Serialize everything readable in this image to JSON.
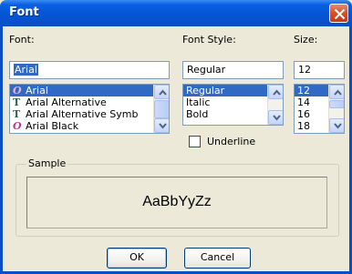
{
  "window": {
    "title": "Font"
  },
  "font": {
    "label": "Font:",
    "value": "Arial",
    "items": [
      {
        "name": "Arial",
        "icon": "opentype-icon"
      },
      {
        "name": "Arial Alternative",
        "icon": "truetype-icon"
      },
      {
        "name": "Arial Alternative Symb",
        "icon": "truetype-icon"
      },
      {
        "name": "Arial Black",
        "icon": "opentype-icon"
      }
    ]
  },
  "style": {
    "label": "Font Style:",
    "value": "Regular",
    "items": [
      "Regular",
      "Italic",
      "Bold"
    ]
  },
  "size": {
    "label": "Size:",
    "value": "12",
    "items": [
      "12",
      "14",
      "16",
      "18"
    ]
  },
  "underline": {
    "label": "Underline",
    "checked": false
  },
  "sample": {
    "legend": "Sample",
    "text": "AaBbYyZz"
  },
  "buttons": {
    "ok": "OK",
    "cancel": "Cancel"
  },
  "colors": {
    "titlebar": "#0555d6",
    "selection": "#316ac5",
    "dialog_bg": "#ece9d8",
    "close": "#d5502a"
  }
}
